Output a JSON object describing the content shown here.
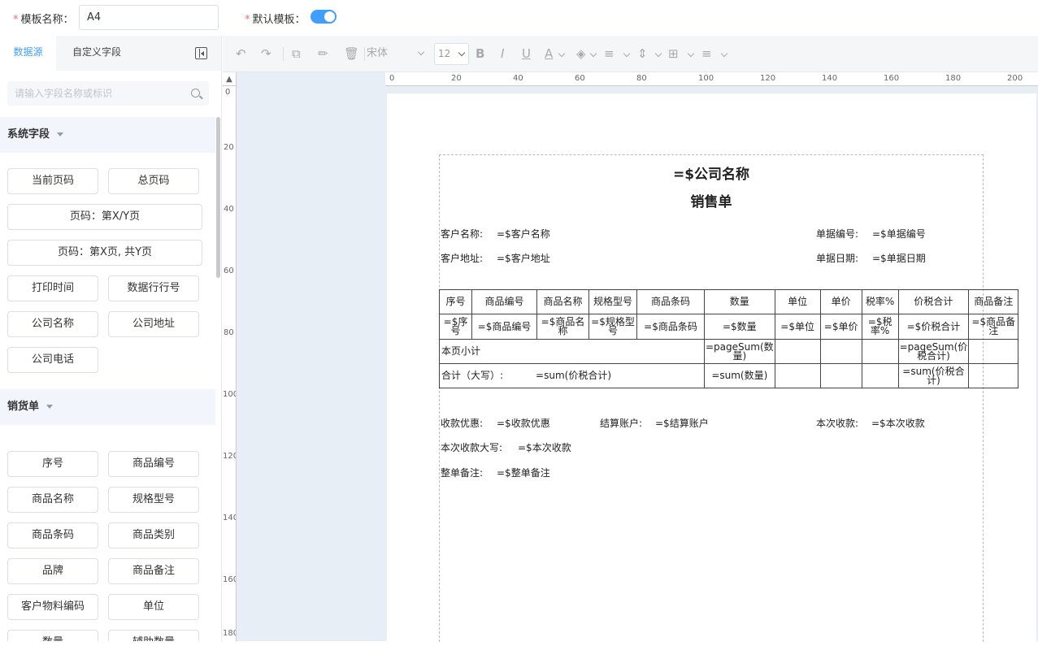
{
  "topbar": {
    "name_label": "模板名称：",
    "name_value": "A4",
    "default_label": "默认模板：",
    "default_on": true,
    "required_mark": "*"
  },
  "colors": {
    "accent": "#409eff",
    "section_bg": "#f2f6fc",
    "canvas_bg": "#e8eef5"
  },
  "left": {
    "tabs": [
      "数据源",
      "自定义字段"
    ],
    "search_placeholder": "请输入字段名称或标识",
    "sections": [
      {
        "title": "系统字段",
        "fields": [
          "当前页码",
          "总页码",
          "页码：第X/Y页",
          "页码：第X页, 共Y页",
          "打印时间",
          "数据行行号",
          "公司名称",
          "公司地址",
          "公司电话"
        ]
      },
      {
        "title": "销货单",
        "fields": [
          "序号",
          "商品编号",
          "商品名称",
          "规格型号",
          "商品条码",
          "商品类别",
          "品牌",
          "商品备注",
          "客户物料编码",
          "单位",
          "数量",
          "辅助数量"
        ]
      }
    ]
  },
  "toolbar": {
    "font": "宋体",
    "size": "12",
    "icons": [
      "undo-icon",
      "redo-icon",
      "copy-icon",
      "format-painter-icon",
      "delete-icon",
      "bold-icon",
      "italic-icon",
      "underline-icon",
      "font-color-icon",
      "fill-color-icon",
      "align-icon",
      "valign-icon",
      "border-icon",
      "distribute-icon"
    ]
  },
  "ruler": {
    "top": [
      "0",
      "20",
      "40",
      "60",
      "80",
      "100",
      "120",
      "140",
      "160",
      "180",
      "200"
    ],
    "left": [
      "0",
      "20",
      "40",
      "60",
      "80",
      "100",
      "120",
      "140",
      "160",
      "180"
    ]
  },
  "doc": {
    "company": "=$公司名称",
    "title": "销售单",
    "customer_label": "客户名称:",
    "customer_value": "=$客户名称",
    "docno_label": "单据编号:",
    "docno_value": "=$单据编号",
    "address_label": "客户地址:",
    "address_value": "=$客户地址",
    "date_label": "单据日期:",
    "date_value": "=$单据日期",
    "table": {
      "headers": [
        "序号",
        "商品编号",
        "商品名称",
        "规格型号",
        "商品条码",
        "数量",
        "单位",
        "单价",
        "税率%",
        "价税合计",
        "商品备注"
      ],
      "row": [
        "=$序号",
        "=$商品编号",
        "=$商品名称",
        "=$规格型号",
        "=$商品条码",
        "=$数量",
        "=$单位",
        "=$单价",
        "=$税率%",
        "=$价税合计",
        "=$商品备注"
      ],
      "subtotal_label": "本页小计",
      "subtotal_qty": "=pageSum(数量)",
      "subtotal_amount": "=pageSum(价税合计)",
      "total_label": "合计（大写）:",
      "total_text": "=sum(价税合计)",
      "total_qty": "=sum(数量)",
      "total_amount": "=sum(价税合计)"
    },
    "discount_label": "收款优惠:",
    "discount_value": "=$收款优惠",
    "account_label": "结算账户:",
    "account_value": "=$结算账户",
    "received_label": "本次收款:",
    "received_value": "=$本次收款",
    "received_cap_label": "本次收款大写:",
    "received_cap_value": "=$本次收款",
    "remark_label": "整单备注:",
    "remark_value": "=$整单备注"
  }
}
